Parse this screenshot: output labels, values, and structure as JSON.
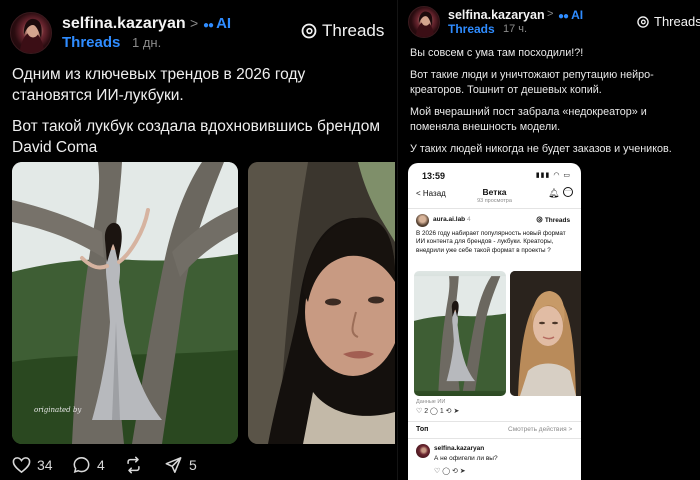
{
  "left_post": {
    "username": "selfina.kazaryan",
    "chevron": ">",
    "ai_tag": "AI",
    "threads_link": "Threads",
    "time": "1 дн.",
    "threads_logo": "Threads",
    "paragraphs": [
      "Одним из ключевых трендов в 2026 году становятся ИИ-лукбуки.",
      "Вот такой лукбук создала вдохновившись брендом David Coma"
    ],
    "images": [
      {
        "icon": "photo-woman-grey-gown-tree"
      },
      {
        "icon": "photo-woman-face-closeup"
      }
    ],
    "watermark": "originated by",
    "actions": {
      "likes": "34",
      "comments": "4",
      "reposts": "",
      "shares": "5"
    }
  },
  "right_post": {
    "username": "selfina.kazaryan",
    "chevron": ">",
    "ai_tag": "AI",
    "threads_link": "Threads",
    "time": "17 ч.",
    "threads_logo": "Threads",
    "paragraphs": [
      "Вы совсем с ума там посходили!?!",
      "Вот такие люди и уничтожают репутацию нейро-креаторов. Тошнит от дешевых копий.",
      "Мой вчерашний пост забрала «недокреатор» и поменяла внешность модели.",
      "У таких людей никогда не будет заказов и учеников."
    ]
  },
  "phone": {
    "status_time": "13:59",
    "signal": "▮▮▮ ◠ ▭",
    "back": "< Назад",
    "title": "Ветка",
    "subtitle": "93 просмотра",
    "post_user": "aura.ai.lab",
    "post_time": "4",
    "threads_logo": "Threads",
    "post_text": "В 2026 году набирает популярность новый формат ИИ контента для брендов - лукбуки. Креаторы, внедрили уже себе такой формат в проекты ?",
    "ai_label": "Данные ИИ",
    "post_actions": "♡ 2   ◯ 1   ⟲   ➤",
    "top_label": "Топ",
    "view_activity": "Смотреть действия  >",
    "comment_user": "selfina.kazaryan",
    "comment_text": "А не офигели ли вы?",
    "comment_actions": "♡   ◯   ⟲   ➤"
  },
  "colors": {
    "background": "#000000",
    "accent": "#2f8cff",
    "text": "#f2f2f2",
    "muted": "#8b8b8b"
  }
}
